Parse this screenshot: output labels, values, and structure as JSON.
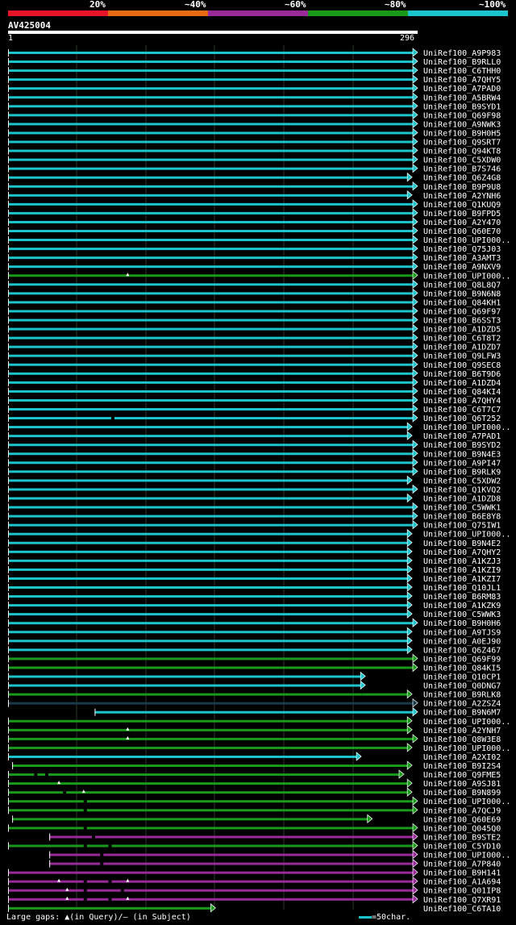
{
  "legend": {
    "labels": [
      "20%",
      "~40%",
      "~60%",
      "~80%",
      "~100%"
    ],
    "colors": [
      "#e8142a",
      "#e86a12",
      "#9a2a9a",
      "#1a9a1a",
      "#1cc4cc"
    ]
  },
  "query": {
    "name": "AV425004",
    "start": "1",
    "end": "296",
    "length": 296
  },
  "hits": [
    {
      "name": "UniRef100_A9P983",
      "color": "cyan",
      "start": 1,
      "end": 296
    },
    {
      "name": "UniRef100_B9RLL0",
      "color": "cyan",
      "start": 1,
      "end": 296
    },
    {
      "name": "UniRef100_C6THH0",
      "color": "cyan",
      "start": 1,
      "end": 296
    },
    {
      "name": "UniRef100_A7QHY5",
      "color": "cyan",
      "start": 1,
      "end": 296
    },
    {
      "name": "UniRef100_A7PAD0",
      "color": "cyan",
      "start": 1,
      "end": 296
    },
    {
      "name": "UniRef100_A5BRW4",
      "color": "cyan",
      "start": 1,
      "end": 296
    },
    {
      "name": "UniRef100_B9SYD1",
      "color": "cyan",
      "start": 1,
      "end": 296
    },
    {
      "name": "UniRef100_Q69F98",
      "color": "cyan",
      "start": 1,
      "end": 296
    },
    {
      "name": "UniRef100_A9NWK3",
      "color": "cyan",
      "start": 1,
      "end": 296
    },
    {
      "name": "UniRef100_B9H0H5",
      "color": "cyan",
      "start": 1,
      "end": 296
    },
    {
      "name": "UniRef100_Q9SRT7",
      "color": "cyan",
      "start": 1,
      "end": 296
    },
    {
      "name": "UniRef100_Q94KT8",
      "color": "cyan",
      "start": 1,
      "end": 296
    },
    {
      "name": "UniRef100_C5XDW0",
      "color": "cyan",
      "start": 1,
      "end": 296
    },
    {
      "name": "UniRef100_B7S746",
      "color": "cyan",
      "start": 1,
      "end": 296
    },
    {
      "name": "UniRef100_Q6Z4G8",
      "color": "cyan",
      "start": 1,
      "end": 292
    },
    {
      "name": "UniRef100_B9P9U8",
      "color": "cyan",
      "start": 1,
      "end": 296
    },
    {
      "name": "UniRef100_A2YNH6",
      "color": "cyan",
      "start": 1,
      "end": 292
    },
    {
      "name": "UniRef100_Q1KUQ9",
      "color": "cyan",
      "start": 1,
      "end": 296
    },
    {
      "name": "UniRef100_B9FPD5",
      "color": "cyan",
      "start": 1,
      "end": 296
    },
    {
      "name": "UniRef100_A2Y470",
      "color": "cyan",
      "start": 1,
      "end": 296
    },
    {
      "name": "UniRef100_Q60E70",
      "color": "cyan",
      "start": 1,
      "end": 296
    },
    {
      "name": "UniRef100_UPI000..",
      "color": "cyan",
      "start": 1,
      "end": 296
    },
    {
      "name": "UniRef100_Q75J03",
      "color": "cyan",
      "start": 1,
      "end": 296
    },
    {
      "name": "UniRef100_A3AMT3",
      "color": "cyan",
      "start": 1,
      "end": 296
    },
    {
      "name": "UniRef100_A9NXV9",
      "color": "cyan",
      "start": 1,
      "end": 296
    },
    {
      "name": "UniRef100_UPI000..",
      "color": "green",
      "start": 1,
      "end": 296,
      "qgaps": [
        88
      ]
    },
    {
      "name": "UniRef100_Q8L8Q7",
      "color": "cyan",
      "start": 1,
      "end": 296
    },
    {
      "name": "UniRef100_B9N6N8",
      "color": "cyan",
      "start": 1,
      "end": 296
    },
    {
      "name": "UniRef100_Q84KH1",
      "color": "cyan",
      "start": 1,
      "end": 296
    },
    {
      "name": "UniRef100_Q69F97",
      "color": "cyan",
      "start": 1,
      "end": 296
    },
    {
      "name": "UniRef100_B6SST3",
      "color": "cyan",
      "start": 1,
      "end": 296
    },
    {
      "name": "UniRef100_A1DZD5",
      "color": "cyan",
      "start": 1,
      "end": 296
    },
    {
      "name": "UniRef100_C6T8T2",
      "color": "cyan",
      "start": 1,
      "end": 296
    },
    {
      "name": "UniRef100_A1DZD7",
      "color": "cyan",
      "start": 1,
      "end": 296
    },
    {
      "name": "UniRef100_Q9LFW3",
      "color": "cyan",
      "start": 1,
      "end": 296
    },
    {
      "name": "UniRef100_Q9SEC8",
      "color": "cyan",
      "start": 1,
      "end": 296
    },
    {
      "name": "UniRef100_B6T9D6",
      "color": "cyan",
      "start": 1,
      "end": 296
    },
    {
      "name": "UniRef100_A1DZD4",
      "color": "cyan",
      "start": 1,
      "end": 296
    },
    {
      "name": "UniRef100_Q84KI4",
      "color": "cyan",
      "start": 1,
      "end": 296
    },
    {
      "name": "UniRef100_A7QHY4",
      "color": "cyan",
      "start": 1,
      "end": 296
    },
    {
      "name": "UniRef100_C6T7C7",
      "color": "cyan",
      "start": 1,
      "end": 296
    },
    {
      "name": "UniRef100_Q6T252",
      "color": "cyan",
      "start": 1,
      "end": 296,
      "sgaps": [
        76
      ]
    },
    {
      "name": "UniRef100_UPI000..",
      "color": "cyan",
      "start": 1,
      "end": 292
    },
    {
      "name": "UniRef100_A7PAD1",
      "color": "cyan",
      "start": 1,
      "end": 292
    },
    {
      "name": "UniRef100_B9SYD2",
      "color": "cyan",
      "start": 1,
      "end": 296
    },
    {
      "name": "UniRef100_B9N4E3",
      "color": "cyan",
      "start": 1,
      "end": 296
    },
    {
      "name": "UniRef100_A9PI47",
      "color": "cyan",
      "start": 1,
      "end": 296
    },
    {
      "name": "UniRef100_B9RLK9",
      "color": "cyan",
      "start": 1,
      "end": 296
    },
    {
      "name": "UniRef100_C5XDW2",
      "color": "cyan",
      "start": 1,
      "end": 292
    },
    {
      "name": "UniRef100_Q1KVQ2",
      "color": "cyan",
      "start": 1,
      "end": 296
    },
    {
      "name": "UniRef100_A1DZD8",
      "color": "cyan",
      "start": 1,
      "end": 292
    },
    {
      "name": "UniRef100_C5WWK1",
      "color": "cyan",
      "start": 1,
      "end": 296
    },
    {
      "name": "UniRef100_B6E8Y8",
      "color": "cyan",
      "start": 1,
      "end": 296
    },
    {
      "name": "UniRef100_Q75IW1",
      "color": "cyan",
      "start": 1,
      "end": 296
    },
    {
      "name": "UniRef100_UPI000..",
      "color": "cyan",
      "start": 1,
      "end": 292
    },
    {
      "name": "UniRef100_B9N4E2",
      "color": "cyan",
      "start": 1,
      "end": 292
    },
    {
      "name": "UniRef100_A7QHY2",
      "color": "cyan",
      "start": 1,
      "end": 292
    },
    {
      "name": "UniRef100_A1KZJ3",
      "color": "cyan",
      "start": 1,
      "end": 292
    },
    {
      "name": "UniRef100_A1KZI9",
      "color": "cyan",
      "start": 1,
      "end": 292
    },
    {
      "name": "UniRef100_A1KZI7",
      "color": "cyan",
      "start": 1,
      "end": 292
    },
    {
      "name": "UniRef100_Q10JL1",
      "color": "cyan",
      "start": 1,
      "end": 292
    },
    {
      "name": "UniRef100_B6RM83",
      "color": "cyan",
      "start": 1,
      "end": 292
    },
    {
      "name": "UniRef100_A1KZK9",
      "color": "cyan",
      "start": 1,
      "end": 292
    },
    {
      "name": "UniRef100_C5WWK3",
      "color": "cyan",
      "start": 1,
      "end": 292
    },
    {
      "name": "UniRef100_B9H0H6",
      "color": "cyan",
      "start": 1,
      "end": 296
    },
    {
      "name": "UniRef100_A9TJS9",
      "color": "cyan",
      "start": 1,
      "end": 292
    },
    {
      "name": "UniRef100_A0EJ90",
      "color": "cyan",
      "start": 1,
      "end": 292
    },
    {
      "name": "UniRef100_Q6Z467",
      "color": "cyan",
      "start": 1,
      "end": 292
    },
    {
      "name": "UniRef100_Q69F99",
      "color": "green",
      "start": 1,
      "end": 296
    },
    {
      "name": "UniRef100_Q84KI5",
      "color": "green",
      "start": 1,
      "end": 296
    },
    {
      "name": "UniRef100_Q10CP1",
      "color": "cyan",
      "start": 1,
      "end": 258
    },
    {
      "name": "UniRef100_Q0DNG7",
      "color": "cyan",
      "start": 1,
      "end": 258
    },
    {
      "name": "UniRef100_B9RLK8",
      "color": "green",
      "start": 1,
      "end": 292,
      "darkfrom": 258
    },
    {
      "name": "UniRef100_A2ZSZ4",
      "color": "dark",
      "start": 1,
      "end": 296
    },
    {
      "name": "UniRef100_B9N6M7",
      "color": "cyan",
      "start": 64,
      "end": 296
    },
    {
      "name": "UniRef100_UPI000..",
      "color": "green",
      "start": 1,
      "end": 292
    },
    {
      "name": "UniRef100_A2YNH7",
      "color": "green",
      "start": 1,
      "end": 292,
      "qgaps": [
        88
      ]
    },
    {
      "name": "UniRef100_Q8W3E8",
      "color": "green",
      "start": 1,
      "end": 296,
      "qgaps": [
        88
      ]
    },
    {
      "name": "UniRef100_UPI000..",
      "color": "green",
      "start": 1,
      "end": 292
    },
    {
      "name": "UniRef100_A2XI02",
      "color": "cyan",
      "start": 1,
      "end": 255
    },
    {
      "name": "UniRef100_B9I2S4",
      "color": "green",
      "start": 4,
      "end": 292
    },
    {
      "name": "UniRef100_Q9FME5",
      "color": "green",
      "start": 1,
      "end": 286,
      "sgaps": [
        20,
        28
      ]
    },
    {
      "name": "UniRef100_A9SJ81",
      "color": "green",
      "start": 1,
      "end": 292,
      "qgaps": [
        38
      ]
    },
    {
      "name": "UniRef100_B9N899",
      "color": "green",
      "start": 1,
      "end": 292,
      "qgaps": [
        56
      ],
      "sgaps": [
        41
      ]
    },
    {
      "name": "UniRef100_UPI000..",
      "color": "green",
      "start": 1,
      "end": 296,
      "sgaps": [
        56
      ]
    },
    {
      "name": "UniRef100_A7QCJ9",
      "color": "green",
      "start": 1,
      "end": 296,
      "sgaps": [
        56
      ]
    },
    {
      "name": "UniRef100_Q60E69",
      "color": "green",
      "start": 4,
      "end": 263
    },
    {
      "name": "UniRef100_Q045Q0",
      "color": "green",
      "start": 1,
      "end": 296,
      "sgaps": [
        56
      ]
    },
    {
      "name": "UniRef100_B9STE2",
      "color": "purple",
      "start": 31,
      "end": 296,
      "sgaps": [
        62
      ]
    },
    {
      "name": "UniRef100_C5YD10",
      "color": "green",
      "start": 1,
      "end": 296,
      "sgaps": [
        56,
        74
      ]
    },
    {
      "name": "UniRef100_UPI000..",
      "color": "purple",
      "start": 31,
      "end": 296,
      "sgaps": [
        68
      ]
    },
    {
      "name": "UniRef100_A7P840",
      "color": "purple",
      "start": 31,
      "end": 296,
      "sgaps": [
        68
      ]
    },
    {
      "name": "UniRef100_B9H141",
      "color": "purple",
      "start": 1,
      "end": 296
    },
    {
      "name": "UniRef100_A1A694",
      "color": "purple",
      "start": 1,
      "end": 296,
      "qgaps": [
        38,
        88
      ],
      "sgaps": [
        56,
        74
      ]
    },
    {
      "name": "UniRef100_Q01IP8",
      "color": "purple",
      "start": 1,
      "end": 296,
      "qgaps": [
        44
      ],
      "sgaps": [
        56,
        83
      ]
    },
    {
      "name": "UniRef100_Q7XR91",
      "color": "purple",
      "start": 1,
      "end": 296,
      "qgaps": [
        44,
        88
      ],
      "sgaps": [
        56,
        74
      ]
    },
    {
      "name": "UniRef100_C6TA10",
      "color": "green",
      "start": 1,
      "end": 149
    }
  ],
  "footer": {
    "left": "Large gaps: ▲(in Query)/— (in Subject)",
    "right": "=50char."
  }
}
